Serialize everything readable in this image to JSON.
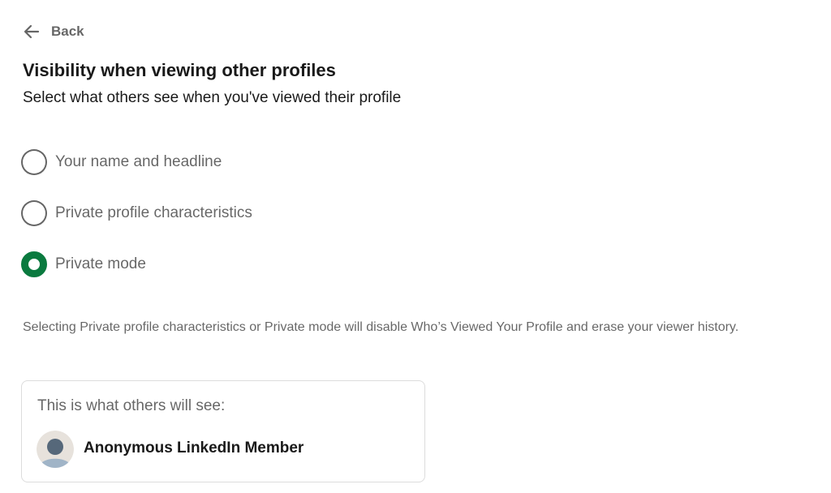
{
  "back": {
    "label": "Back",
    "icon": "arrow-left-icon"
  },
  "header": {
    "title": "Visibility when viewing other profiles",
    "subtitle": "Select what others see when you've viewed their profile"
  },
  "options": [
    {
      "label": "Your name and headline",
      "selected": false
    },
    {
      "label": "Private profile characteristics",
      "selected": false
    },
    {
      "label": "Private mode",
      "selected": true
    }
  ],
  "notice": "Selecting Private profile characteristics or Private mode will disable Who’s Viewed Your Profile and erase your viewer history.",
  "preview": {
    "heading": "This is what others will see:",
    "member_name": "Anonymous LinkedIn Member",
    "avatar_icon": "anonymous-avatar-icon"
  },
  "colors": {
    "accent": "#0a7a3f",
    "text_primary": "rgba(0,0,0,0.9)",
    "text_secondary": "rgba(0,0,0,0.6)",
    "card_border": "#dcdcdc"
  }
}
